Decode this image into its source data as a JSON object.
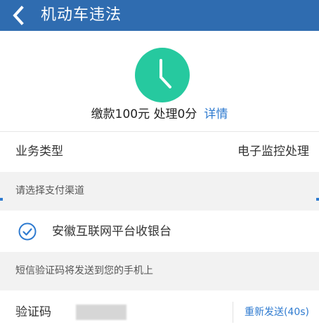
{
  "header": {
    "title": "机动车违法",
    "back_icon": "chevron-left-icon"
  },
  "status": {
    "icon": "clock-icon",
    "icon_color": "#26c99f",
    "summary": "缴款100元 处理0分",
    "detail_link": "详情"
  },
  "business": {
    "label": "业务类型",
    "value": "电子监控处理"
  },
  "payment": {
    "section_title": "请选择支付渠道",
    "selected_option": "安徽互联网平台收银台",
    "selected_icon": "check-circle-icon"
  },
  "sms": {
    "notice": "短信验证码将发送到您的手机上"
  },
  "verify": {
    "label": "验证码",
    "input_placeholder": "",
    "resend_label": "重新发送(40s)"
  },
  "colors": {
    "header": "#2f6cb0",
    "accent": "#2f7bd0",
    "clock": "#26c99f"
  }
}
